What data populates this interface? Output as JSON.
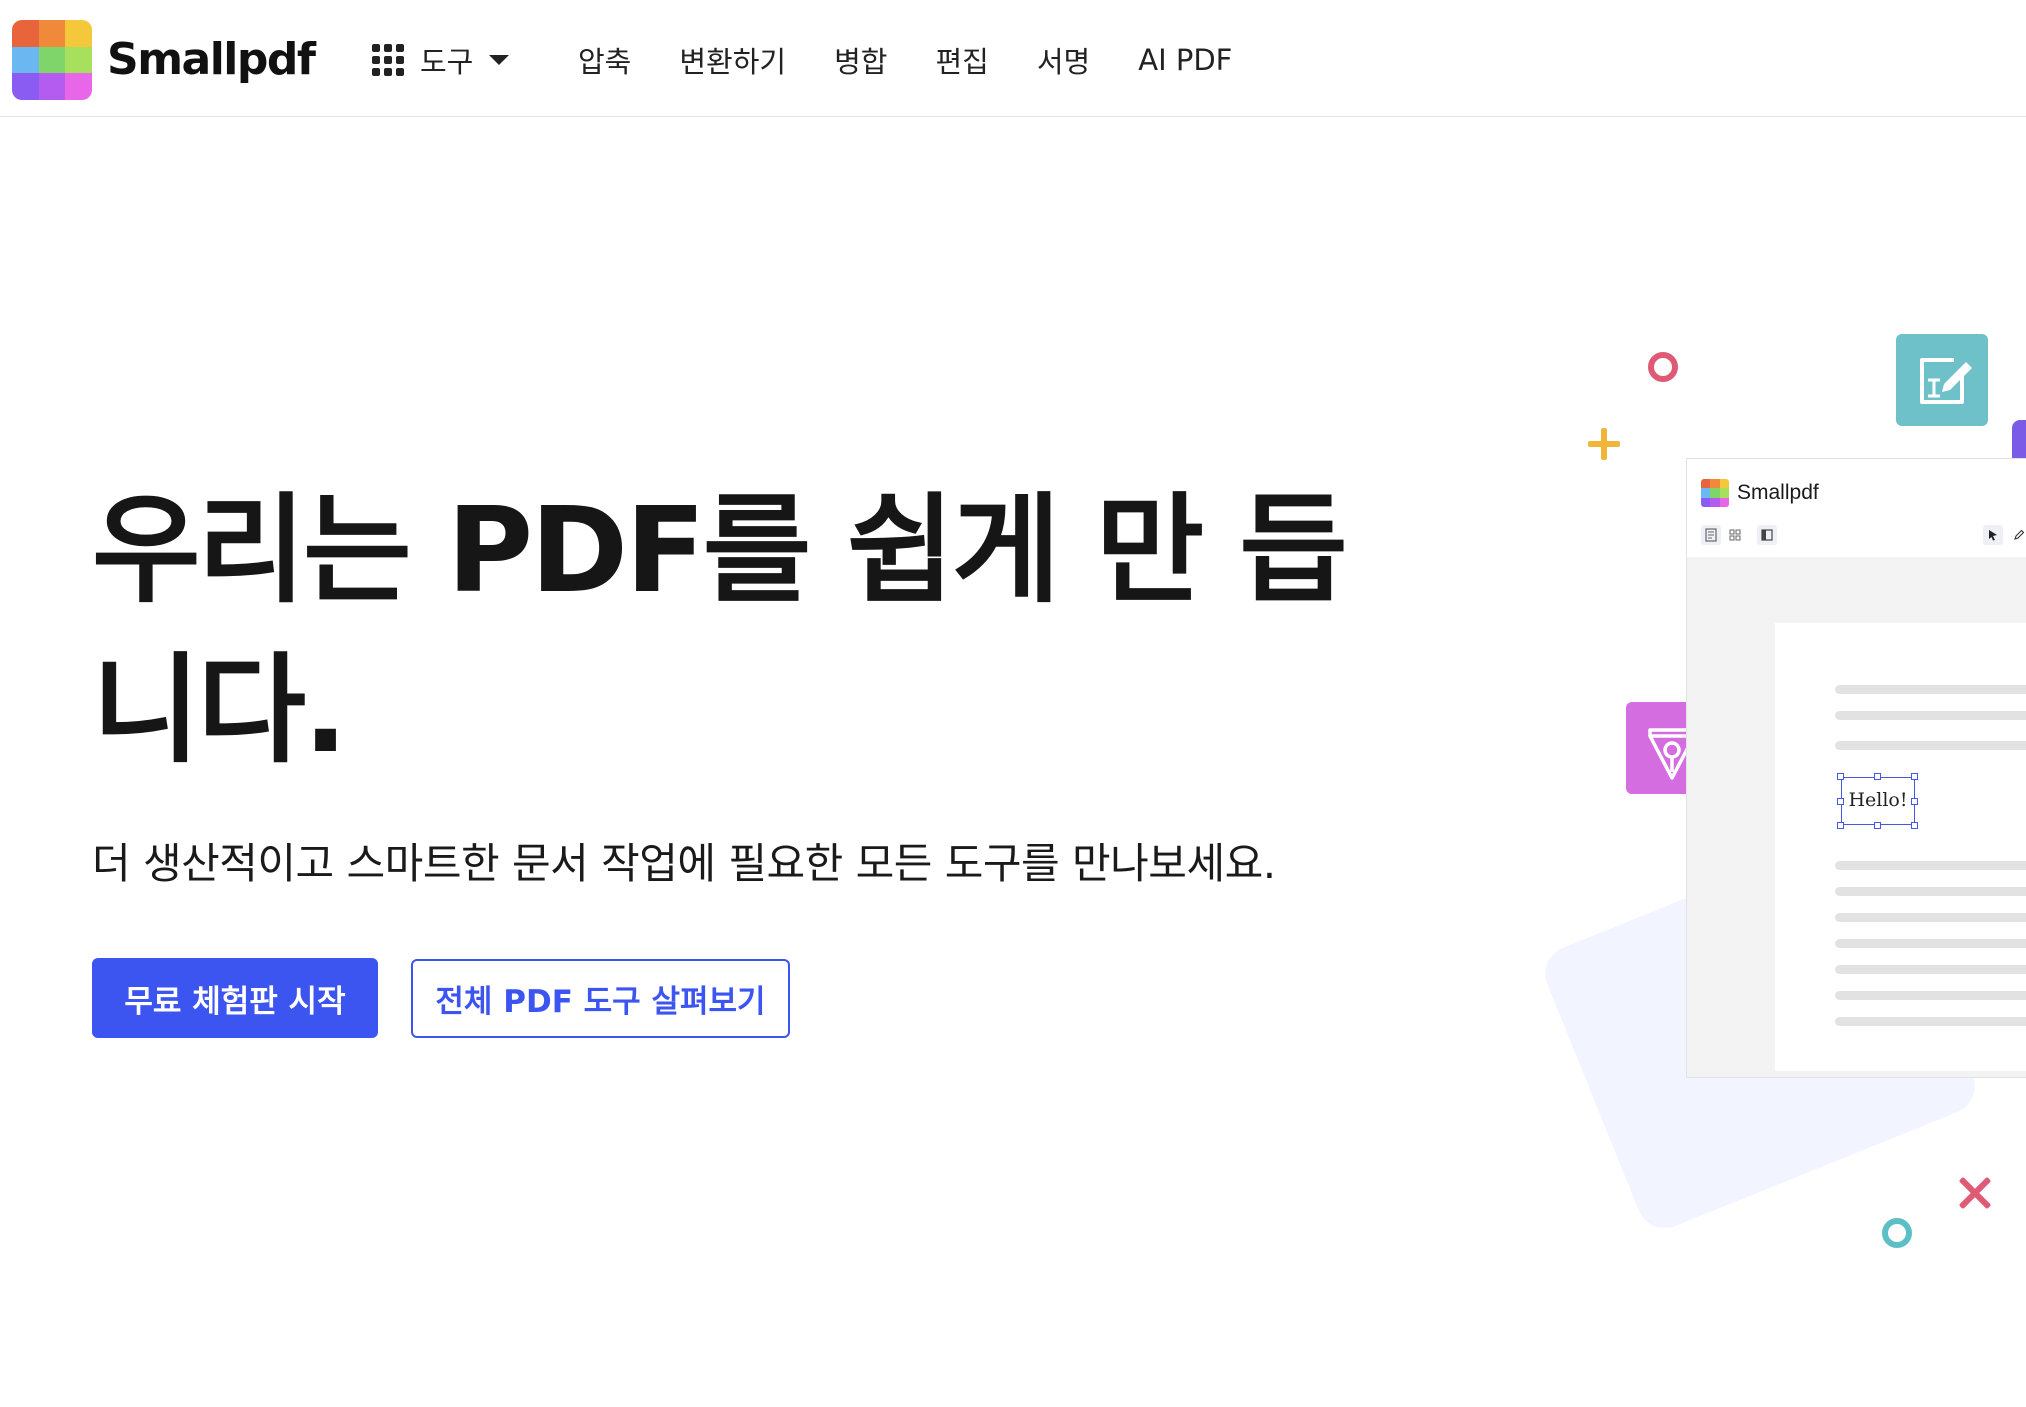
{
  "brand": {
    "name": "Smallpdf",
    "logo_colors": [
      "#e8643a",
      "#f0893a",
      "#f5c83c",
      "#6bb7f2",
      "#7fd46a",
      "#a6e05c",
      "#8a5cf2",
      "#b45cf0",
      "#e867e8"
    ]
  },
  "nav": {
    "tools_label": "도구",
    "links": [
      "압축",
      "변환하기",
      "병합",
      "편집",
      "서명",
      "AI PDF"
    ]
  },
  "hero": {
    "title": "우리는 PDF를 쉽게 만 듭니다.",
    "subtitle": "더 생산적이고 스마트한 문서 작업에 필요한 모든 도구를 만나보세요.",
    "primary_cta": "무료 체험판 시작",
    "secondary_cta": "전체 PDF 도구 살펴보기"
  },
  "illustration": {
    "app_title": "Smallpdf",
    "annotation_text": "Hello!"
  },
  "colors": {
    "accent": "#3d55f0",
    "tile_edit": "#6ec1c8",
    "tile_pen": "#d46ee0",
    "deco_red": "#e05a75",
    "deco_yellow": "#f0b63a",
    "deco_teal": "#5cbfc6"
  }
}
